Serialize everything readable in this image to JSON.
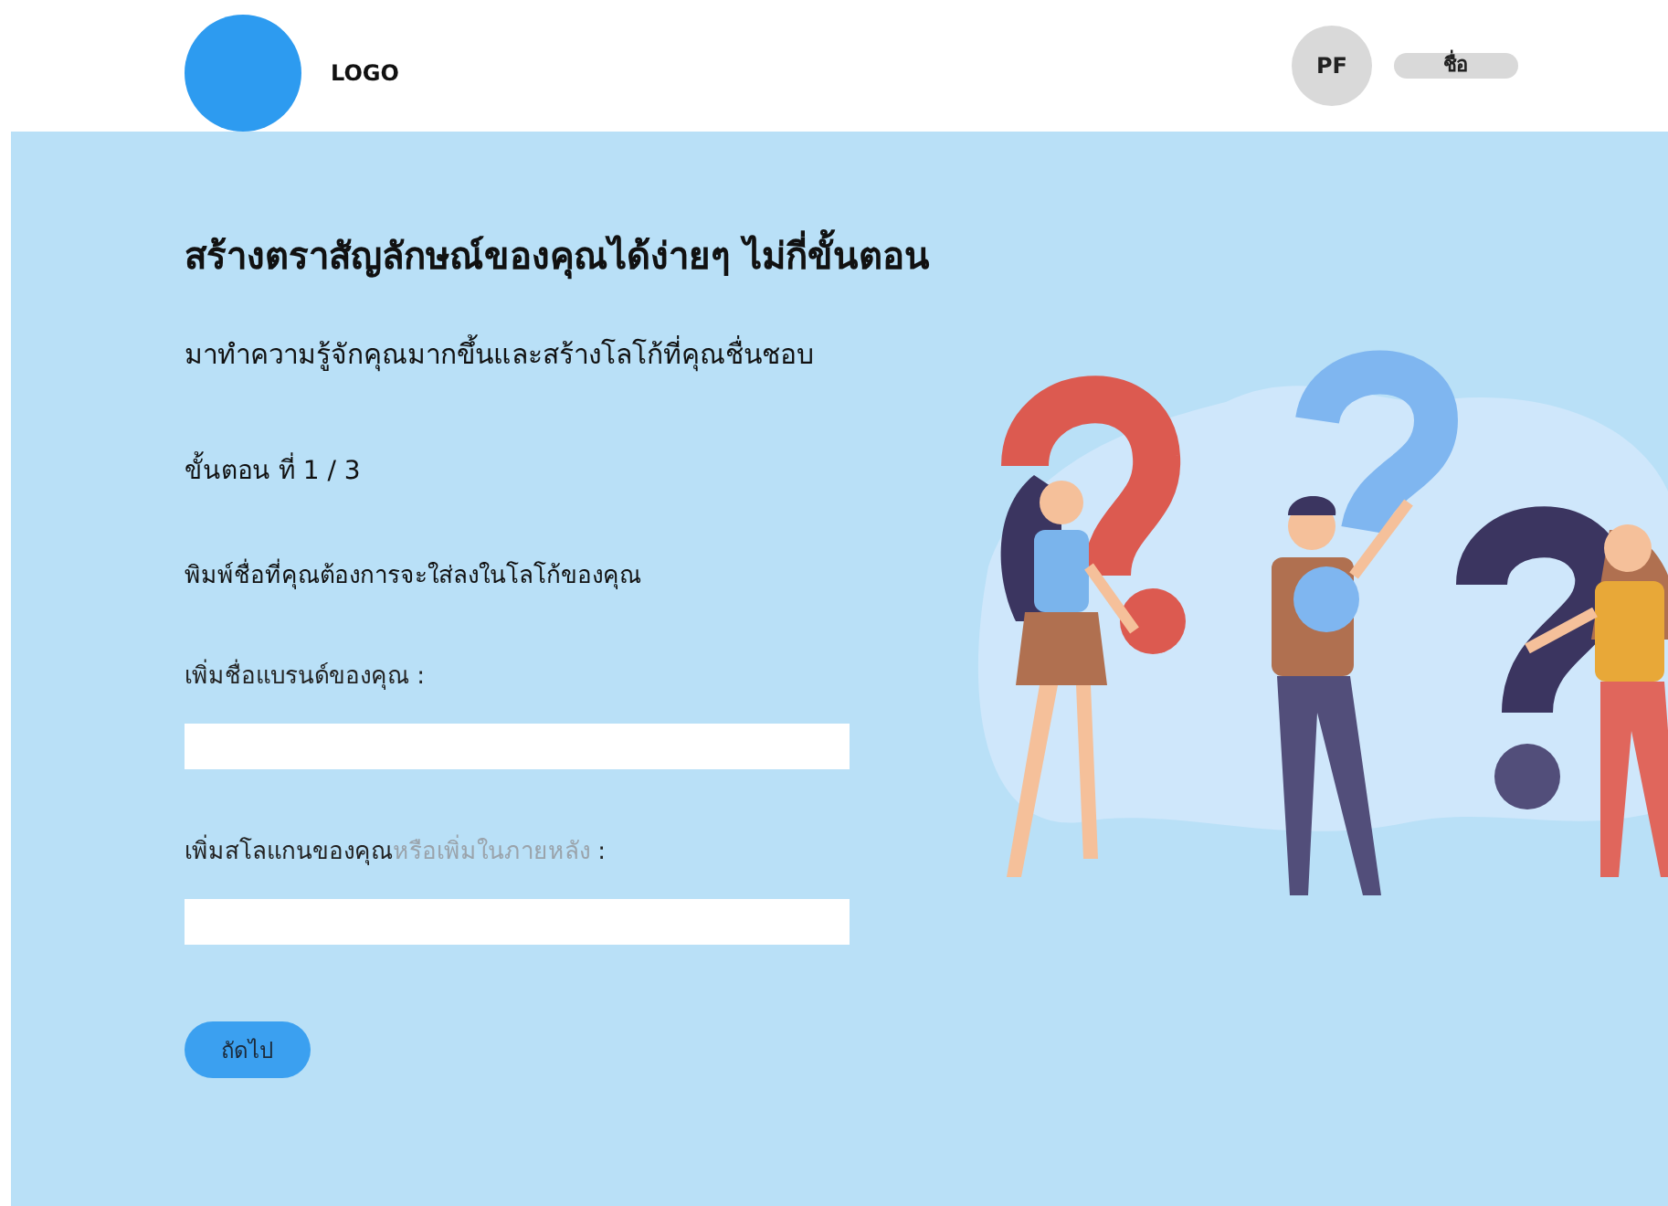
{
  "header": {
    "logo_text": "LOGO",
    "avatar_initials": "PF",
    "user_name": "ชื่อ"
  },
  "intro": {
    "title": "สร้างตราสัญลักษณ์ของคุณได้ง่ายๆ ไม่กี่ขั้นตอน",
    "subtitle": "มาทำความรู้จักคุณมากขึ้นและสร้างโลโก้ที่คุณชื่นชอบ",
    "step": "ขั้นตอน ที่ 1 / 3",
    "instruction": "พิมพ์ชื่อที่คุณต้องการจะใส่ลงในโลโก้ของคุณ"
  },
  "fields": [
    {
      "label": "เพิ่มชื่อแบรนด์ของคุณ :"
    },
    {
      "label": "เพิ่มสโลแกนของคุณ",
      "optional_note": "หรือเพิ่มในภายหลัง",
      "suffix": " :"
    }
  ],
  "next_button": "ถัดไป"
}
